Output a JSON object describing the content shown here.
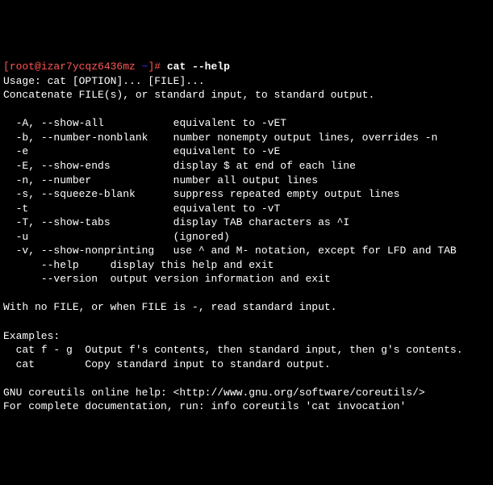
{
  "prompt": {
    "open": "[",
    "userhost": "root@izar7ycqz6436mz",
    "space": " ",
    "tilde": "~",
    "close": "]# ",
    "command": "cat --help"
  },
  "usage": "Usage: cat [OPTION]... [FILE]...",
  "desc": "Concatenate FILE(s), or standard input, to standard output.",
  "optA": "  -A, --show-all           equivalent to -vET",
  "optB": "  -b, --number-nonblank    number nonempty output lines, overrides -n",
  "optE1": "  -e                       equivalent to -vE",
  "optE2": "  -E, --show-ends          display $ at end of each line",
  "optN": "  -n, --number             number all output lines",
  "optS": "  -s, --squeeze-blank      suppress repeated empty output lines",
  "optT1": "  -t                       equivalent to -vT",
  "optT2": "  -T, --show-tabs          display TAB characters as ^I",
  "optU": "  -u                       (ignored)",
  "optV": "  -v, --show-nonprinting   use ^ and M- notation, except for LFD and TAB",
  "optHelp": "      --help     display this help and exit",
  "optVer": "      --version  output version information and exit",
  "nofile": "With no FILE, or when FILE is -, read standard input.",
  "examplesHdr": "Examples:",
  "ex1": "  cat f - g  Output f's contents, then standard input, then g's contents.",
  "ex2": "  cat        Copy standard input to standard output.",
  "help": "GNU coreutils online help: <http://www.gnu.org/software/coreutils/>",
  "info": "For complete documentation, run: info coreutils 'cat invocation'"
}
